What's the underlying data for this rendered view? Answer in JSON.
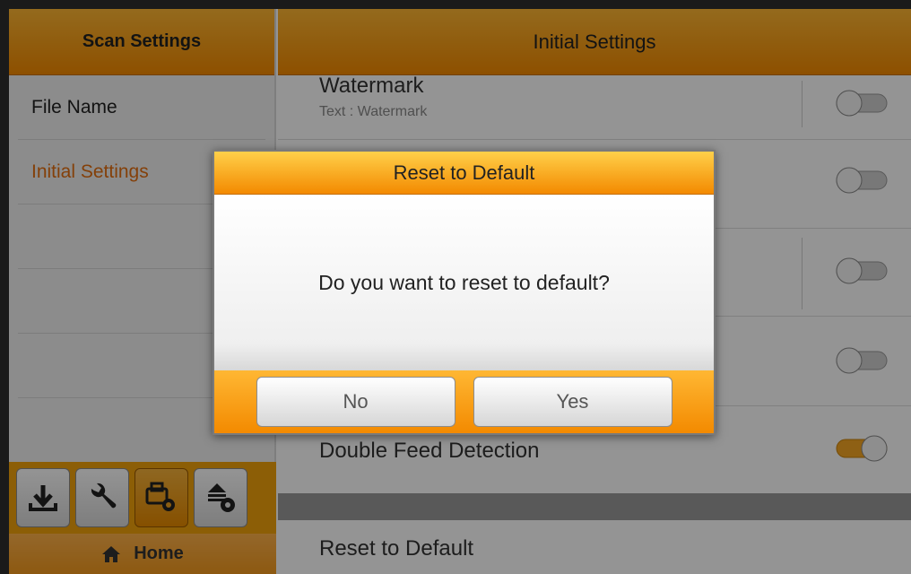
{
  "sidebar": {
    "title": "Scan Settings",
    "items": [
      {
        "label": "File Name"
      },
      {
        "label": "Initial Settings"
      },
      {
        "label": ""
      },
      {
        "label": ""
      },
      {
        "label": ""
      }
    ],
    "home_label": "Home"
  },
  "main": {
    "title": "Initial Settings",
    "rows": [
      {
        "title": "Watermark",
        "subtitle": "Text : Watermark",
        "toggle": "off"
      },
      {
        "title": "",
        "subtitle": "",
        "toggle": "off"
      },
      {
        "title": "",
        "subtitle": "",
        "toggle": "off"
      },
      {
        "title": "",
        "subtitle": "",
        "toggle": "off"
      },
      {
        "title": "Double Feed Detection",
        "subtitle": "",
        "toggle": "on"
      }
    ],
    "reset_label": "Reset to Default"
  },
  "dialog": {
    "title": "Reset to Default",
    "message": "Do you want to reset to default?",
    "no_label": "No",
    "yes_label": "Yes"
  },
  "colors": {
    "accent": "#f39a1e",
    "active_text": "#e36e10",
    "toggle_on": "#f5a623"
  }
}
